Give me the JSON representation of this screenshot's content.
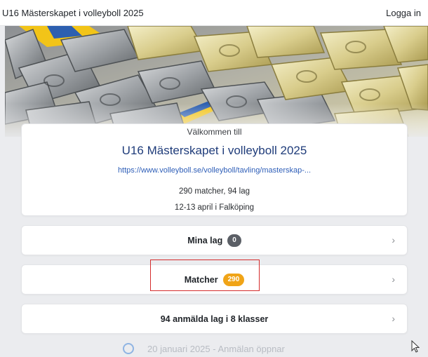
{
  "header": {
    "title": "U16 Mästerskapet i volleyboll 2025",
    "login_label": "Logga in"
  },
  "event": {
    "welcome": "Välkommen till",
    "title": "U16 Mästerskapet i volleyboll 2025",
    "url": "https://www.volleyboll.se/volleyboll/tavling/masterskap-...",
    "stats": "290 matcher, 94 lag",
    "date_place": "12-13 april i Falköping"
  },
  "rows": {
    "my_teams": {
      "label": "Mina lag",
      "count": "0"
    },
    "matches": {
      "label": "Matcher",
      "count": "290"
    },
    "registered": {
      "label": "94 anmälda lag i 8 klasser"
    }
  },
  "timeline": {
    "text": "20 januari 2025 - Anmälan öppnar"
  },
  "colors": {
    "badge_gray": "#5b5f66",
    "badge_orange": "#f0a417",
    "highlight_red": "#d42b2b",
    "title_blue": "#1f3c7a",
    "link_blue": "#2f5fb8"
  },
  "icons": {
    "row_arrow": "chevron-right-icon",
    "cursor": "mouse-pointer-icon"
  }
}
